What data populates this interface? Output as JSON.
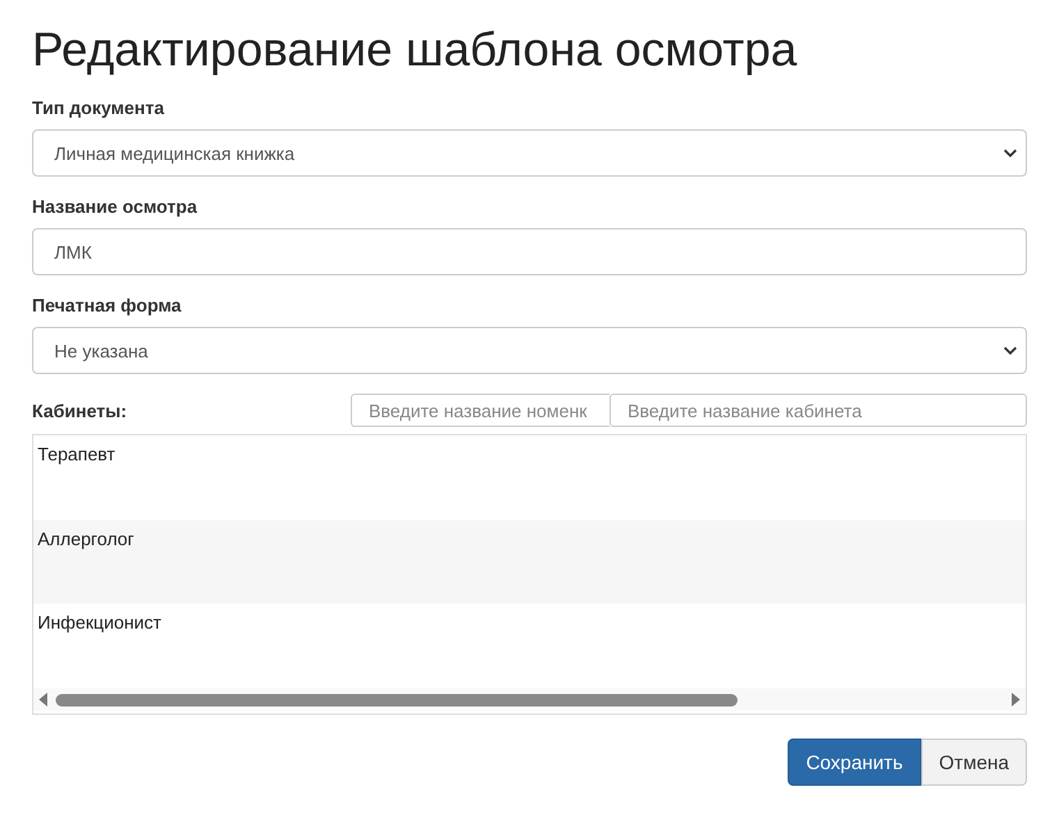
{
  "title": "Редактирование шаблона осмотра",
  "fields": [
    {
      "kind": "select",
      "label": "Тип документа",
      "value": "Личная медицинская книжка"
    },
    {
      "kind": "text",
      "label": "Название осмотра",
      "value": "ЛМК"
    },
    {
      "kind": "select",
      "label": "Печатная форма",
      "value": "Не указана"
    }
  ],
  "cabinets": {
    "label": "Кабинеты:",
    "filters": [
      {
        "placeholder": "Введите название номенк"
      },
      {
        "placeholder": "Введите название кабинета"
      }
    ],
    "items": [
      "Терапевт",
      "Аллерголог",
      "Инфекционист"
    ]
  },
  "buttons": [
    {
      "kind": "primary",
      "label": "Сохранить"
    },
    {
      "kind": "default",
      "label": "Отмена"
    }
  ]
}
